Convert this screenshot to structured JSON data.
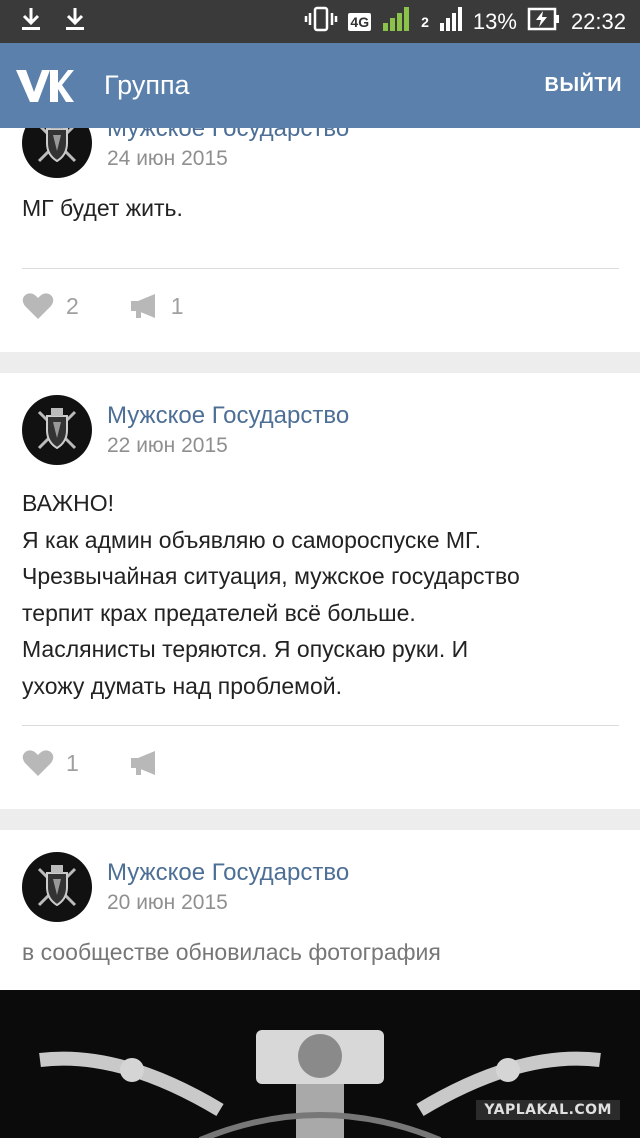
{
  "status_bar": {
    "network": "4G",
    "sim1": "1",
    "sim2": "2",
    "battery": "13%",
    "time": "22:32",
    "icons": [
      "download-icon",
      "download-icon",
      "vibrate-icon",
      "signal-icon",
      "battery-charging-icon"
    ]
  },
  "header": {
    "title": "Группа",
    "action": "ВЫЙТИ",
    "logo_icon": "vk-logo-icon",
    "bg_color": "#5b80ac"
  },
  "posts": [
    {
      "author": "Мужское Государство",
      "date": "24 июн 2015",
      "text": "МГ будет жить.",
      "likes": "2",
      "reposts": "1"
    },
    {
      "author": "Мужское Государство",
      "date": "22 июн 2015",
      "text": "ВАЖНО!\nЯ как админ объявляю о самороспуске МГ.\nЧрезвычайная ситуация, мужское государство\nтерпит крах предателей всё больше.\nМаслянисты теряются. Я опускаю руки. И\nухожу думать над проблемой.",
      "likes": "1",
      "reposts": ""
    },
    {
      "author": "Мужское Государство",
      "date": "20 июн 2015",
      "text": "в сообществе обновилась фотография",
      "watermark": "YAPLAKAL.COM"
    }
  ]
}
